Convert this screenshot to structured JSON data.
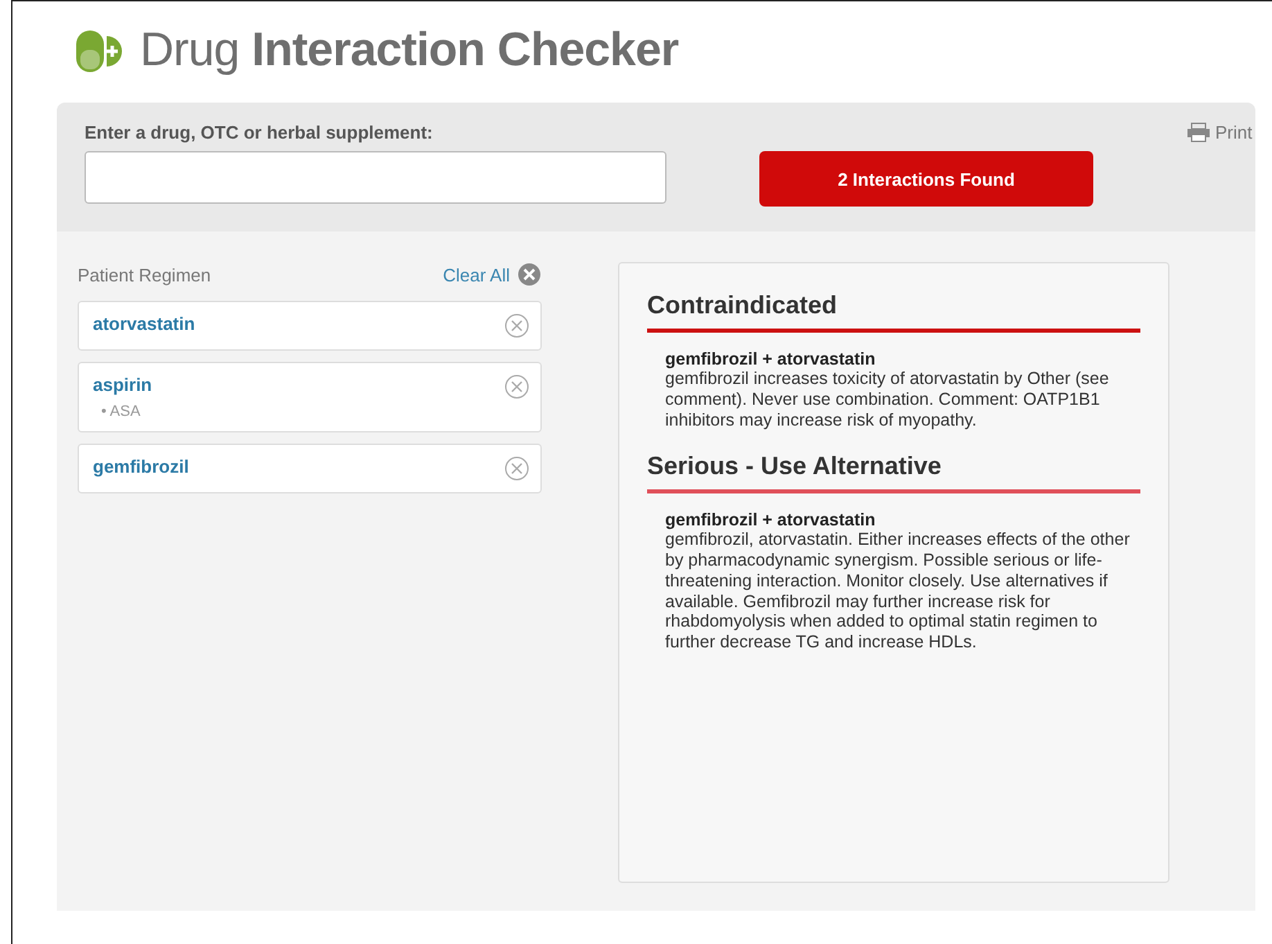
{
  "title": "Drug **Interaction Checker**",
  "search": {
    "label": "Enter a drug, OTC or herbal supplement:"
  },
  "print": "Print",
  "results_button": "2 Interactions Found",
  "regimen": {
    "heading": "Patient Regimen",
    "clear_all": "Clear All",
    "drugs": [
      {
        "name": "atorvastatin"
      },
      {
        "name": "aspirin",
        "aliases": [
          "• ASA"
        ]
      },
      {
        "name": "gemfibrozil"
      }
    ]
  },
  "interactions": [
    {
      "severity": "Contraindicated",
      "color": "#cc1111",
      "pair": "gemfibrozil + atorvastatin",
      "description": "gemfibrozil increases toxicity of atorvastatin by Other (see comment). Never use combination. Comment: OATP1B1 inhibitors may increase risk of myopathy."
    },
    {
      "severity": "Serious - Use Alternative",
      "color": "#e0505a",
      "pair": "gemfibrozil + atorvastatin",
      "description": "gemfibrozil, atorvastatin. Either increases effects of the other by pharmacodynamic synergism. Possible serious or life-threatening interaction. Monitor closely. Use alternatives if available. Gemfibrozil may further increase risk for rhabdomyolysis when added to optimal statin regimen to further decrease TG and increase HDLs."
    }
  ]
}
